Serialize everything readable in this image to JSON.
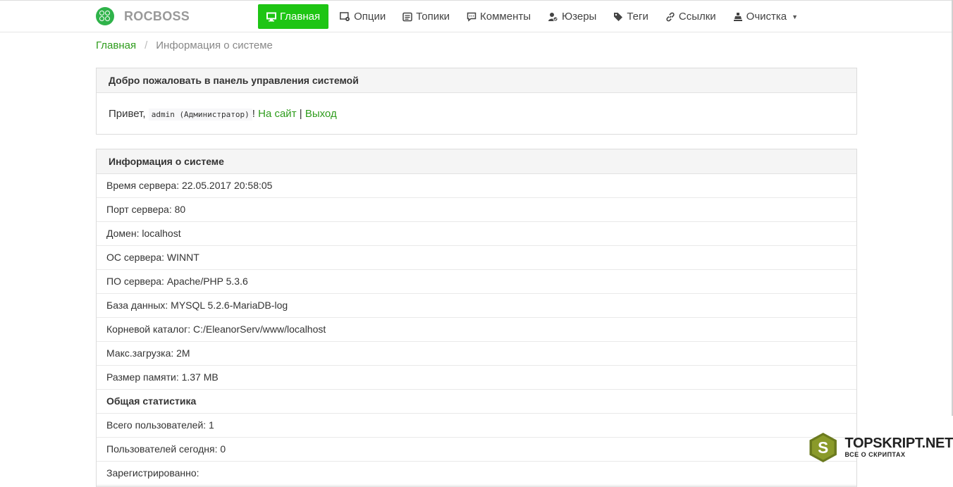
{
  "brand": {
    "name": "ROCBOSS",
    "color": "#2fb34a"
  },
  "nav": [
    {
      "label": "Главная",
      "icon": "monitor-icon",
      "active": true
    },
    {
      "label": "Опции",
      "icon": "settings-icon"
    },
    {
      "label": "Топики",
      "icon": "list-icon"
    },
    {
      "label": "Комменты",
      "icon": "comment-icon"
    },
    {
      "label": "Юзеры",
      "icon": "user-check-icon"
    },
    {
      "label": "Теги",
      "icon": "tag-icon"
    },
    {
      "label": "Ссылки",
      "icon": "link-icon"
    },
    {
      "label": "Очистка",
      "icon": "eraser-icon",
      "dropdown": true
    }
  ],
  "breadcrumb": {
    "home": "Главная",
    "separator": "/",
    "current": "Информация о системе"
  },
  "welcome": {
    "title": "Добро пожаловать в панель управления системой",
    "greeting": "Привет,",
    "user": "admin (Администратор)",
    "exclaim": "!",
    "site_link": "На сайт",
    "divider": "|",
    "logout_link": "Выход"
  },
  "info": {
    "title": "Информация о системе",
    "rows": [
      {
        "text": "Время сервера: 22.05.2017 20:58:05"
      },
      {
        "text": "Порт сервера: 80"
      },
      {
        "text": "Домен: localhost"
      },
      {
        "text": "ОС сервера: WINNT"
      },
      {
        "text": "ПО сервера: Apache/PHP 5.3.6"
      },
      {
        "text": "База данных: MYSQL 5.2.6-MariaDB-log"
      },
      {
        "text": "Корневой каталог: C:/EleanorServ/www/localhost"
      },
      {
        "text": "Макс.загрузка: 2M"
      },
      {
        "text": "Размер памяти: 1.37 MB"
      },
      {
        "text": "Общая статистика",
        "bold": true
      },
      {
        "text": "Всего пользователей: 1"
      },
      {
        "text": "Пользователей сегодня: 0"
      },
      {
        "text": "Зарегистрированно:"
      }
    ]
  },
  "watermark": {
    "title": "TOPSKRIPT.NET",
    "subtitle": "ВСЕ О СКРИПТАХ"
  },
  "colors": {
    "accent": "#1ec514",
    "link": "#2e9c1c"
  }
}
